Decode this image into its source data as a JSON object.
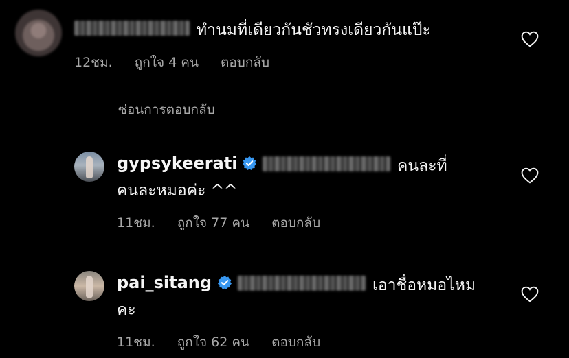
{
  "colors": {
    "background": "#000000",
    "text": "#f5f5f5",
    "meta": "#a8a8a8",
    "verified": "#3897f0"
  },
  "comments": [
    {
      "username": "",
      "text_line1": "ทำนมที่เดียวกันชัวทรงเดียวกันแป๊ะ",
      "text_line2": "",
      "time": "12ชม.",
      "likes": "ถูกใจ 4 คน",
      "reply": "ตอบกลับ",
      "avatar": "blurred-avatar",
      "verified": false
    },
    {
      "username": "gypsykeerati",
      "text_line1": "คนละที่",
      "text_line2": "คนละหมอค่ะ ^^",
      "time": "11ชม.",
      "likes": "ถูกใจ 77 คน",
      "reply": "ตอบกลับ",
      "avatar": "profile-avatar",
      "verified": true
    },
    {
      "username": "pai_sitang",
      "text_line1": "เอาชื่อหมอไหม",
      "text_line2": "คะ",
      "time": "11ชม.",
      "likes": "ถูกใจ 62 คน",
      "reply": "ตอบกลับ",
      "avatar": "profile-avatar",
      "verified": true
    }
  ],
  "hide_replies": "ซ่อนการตอบกลับ",
  "icons": {
    "like": "heart-icon",
    "verified": "verified-badge-icon"
  }
}
